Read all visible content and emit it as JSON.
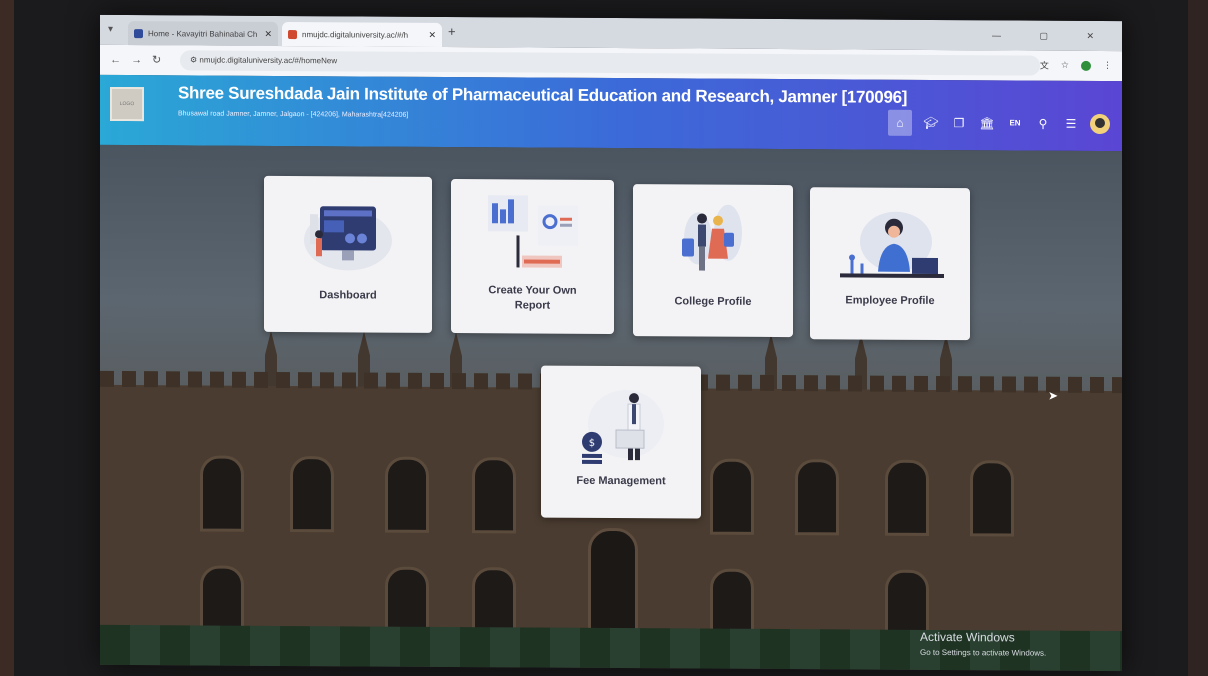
{
  "browser": {
    "tabs": [
      {
        "label": "Home - Kavayitri Bahinabai Ch",
        "active": false
      },
      {
        "label": "nmujdc.digitaluniversity.ac/#/h",
        "active": true
      }
    ],
    "new_tab": "+",
    "window_controls": "— ▢ ✕",
    "url": "nmujdc.digitaluniversity.ac/#/homeNew"
  },
  "header": {
    "logo_alt": "LOGO",
    "institute_name": "Shree Sureshdada Jain Institute of Pharmaceutical Education and Research, Jamner [170096]",
    "address": "Bhusawal road Jamner, Jamner, Jalgaon - [424206], Maharashtra[424206]",
    "language": "EN"
  },
  "cards": [
    {
      "label": "Dashboard"
    },
    {
      "label_line1": "Create Your Own",
      "label_line2": "Report"
    },
    {
      "label": "College Profile"
    },
    {
      "label": "Employee Profile"
    },
    {
      "label": "Fee Management"
    }
  ],
  "watermark": {
    "line1": "Activate Windows",
    "line2": "Go to Settings to activate Windows."
  },
  "colors": {
    "header_start": "#2aa8d6",
    "header_end": "#5a46d4",
    "card_bg": "#f3f3f5"
  }
}
